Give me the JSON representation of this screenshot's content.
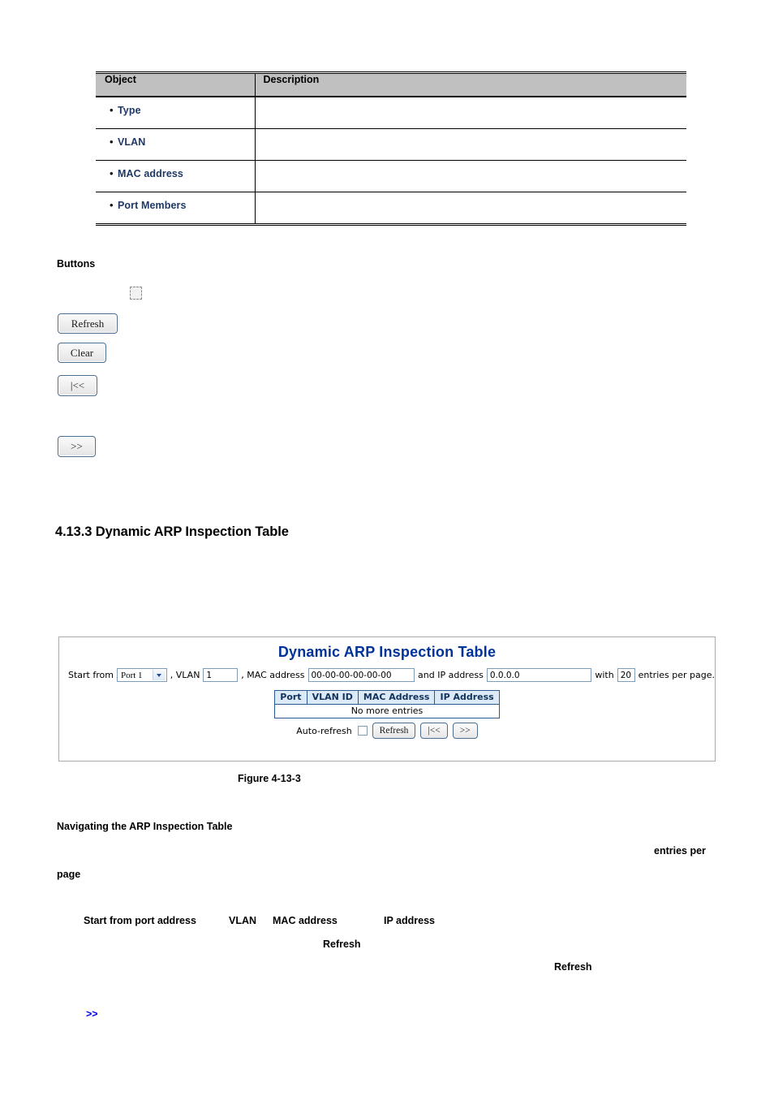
{
  "object_table": {
    "headers": [
      "Object",
      "Description"
    ],
    "rows": [
      {
        "label": "Type",
        "description": ""
      },
      {
        "label": "VLAN",
        "description": ""
      },
      {
        "label": "MAC address",
        "description": ""
      },
      {
        "label": "Port Members",
        "description": ""
      }
    ],
    "bullet_glyph": "•",
    "label_color": "#1f3864",
    "header_bg": "#c0c0c0"
  },
  "buttons_section": {
    "heading": "Buttons",
    "items": [
      {
        "name": "checkbox",
        "label": ""
      },
      {
        "name": "refresh",
        "label": "Refresh"
      },
      {
        "name": "clear",
        "label": "Clear"
      },
      {
        "name": "first-page",
        "label": "|<<"
      },
      {
        "name": "next-page",
        "label": ">>"
      }
    ]
  },
  "section": {
    "number": "4.13.3",
    "heading": "4.13.3 Dynamic ARP Inspection Table"
  },
  "panel": {
    "title": "Dynamic ARP Inspection Table",
    "title_color": "#003399",
    "filter": {
      "start_from_label": "Start from",
      "port_value": "Port 1",
      "vlan_label": ", VLAN",
      "vlan_value": "1",
      "mac_label": ", MAC address",
      "mac_value": "00-00-00-00-00-00",
      "ip_label": "and IP address",
      "ip_value": "0.0.0.0",
      "with_label": "with",
      "entries_value": "20",
      "entries_suffix": "entries per page."
    },
    "table": {
      "headers": [
        "Port",
        "VLAN ID",
        "MAC Address",
        "IP Address"
      ],
      "empty_message": "No more entries",
      "header_bg": "#dce9f7",
      "border_color": "#2d5a8e"
    },
    "actions": {
      "auto_refresh_label": "Auto-refresh",
      "auto_refresh_checked": false,
      "refresh_label": "Refresh",
      "first_label": "|<<",
      "next_label": ">>"
    }
  },
  "figure": {
    "caption": "Figure 4-13-3"
  },
  "prose": {
    "nav_heading": "Navigating the ARP Inspection Table",
    "entries_per": "entries per",
    "page": "page",
    "start_from_port_address": "Start from port address",
    "vlan": "VLAN",
    "mac_address": "MAC address",
    "ip_address": "IP address",
    "refresh_1": "Refresh",
    "refresh_2": "Refresh",
    "next_link": ">>"
  }
}
